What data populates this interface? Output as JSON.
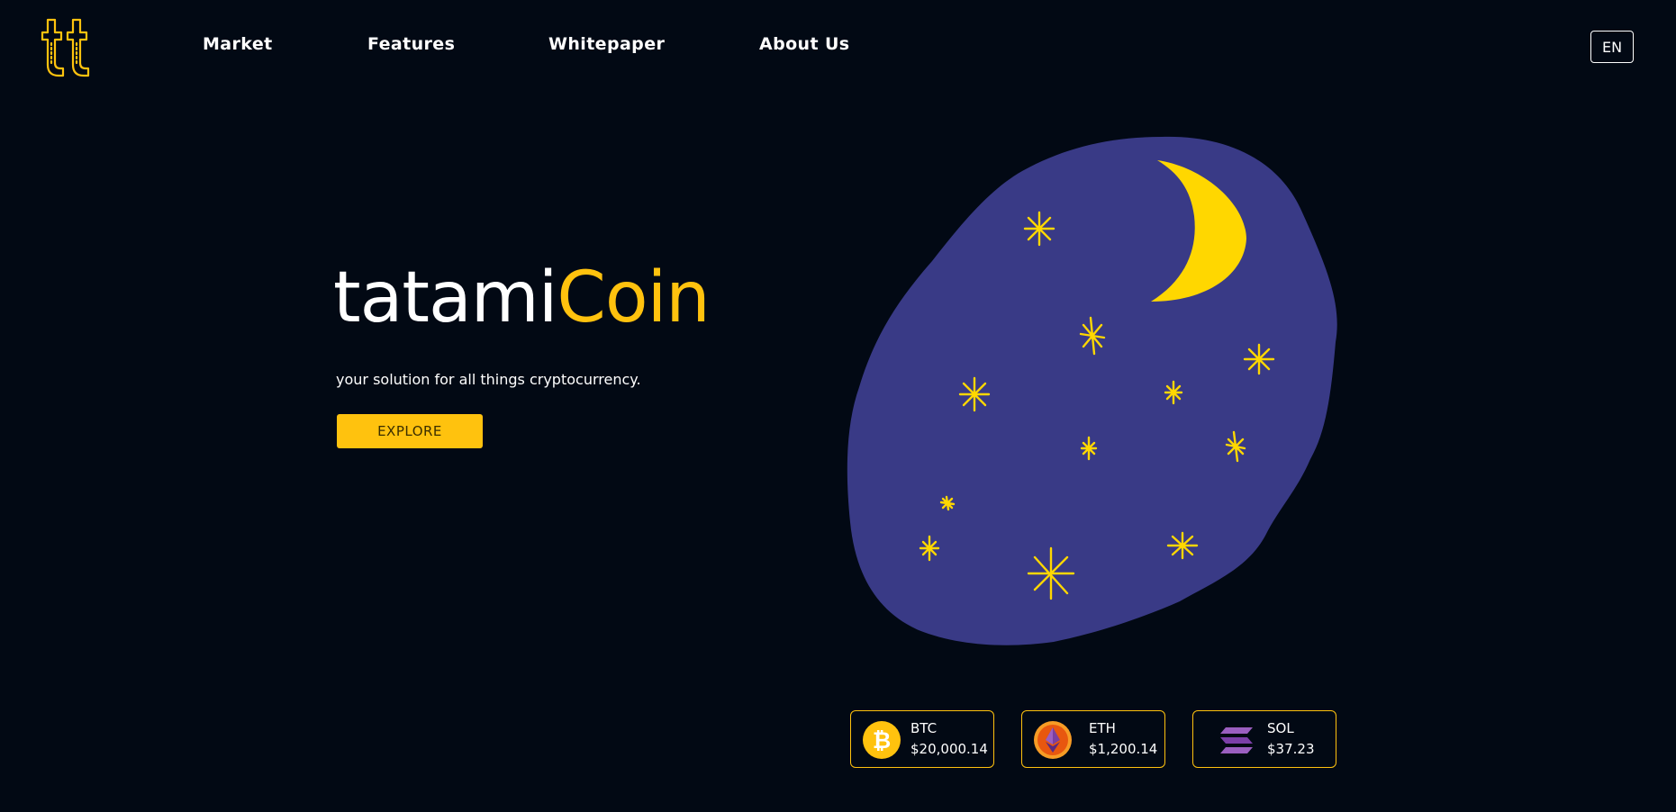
{
  "colors": {
    "background": "#020914",
    "accent": "#ffc20e",
    "blob": "#393a86",
    "text": "#ffffff"
  },
  "header": {
    "logo_text": "tt",
    "nav": [
      {
        "label": "Market"
      },
      {
        "label": "Features"
      },
      {
        "label": "Whitepaper"
      },
      {
        "label": "About Us"
      }
    ],
    "language": "EN"
  },
  "hero": {
    "title_main": "tatami",
    "title_accent": "Coin",
    "tagline": "your solution for all things cryptocurrency.",
    "cta_label": "EXPLORE"
  },
  "illustration": {
    "icons": [
      "moon-icon",
      "star-icon"
    ]
  },
  "tickers": [
    {
      "symbol": "BTC",
      "price": "$20,000.14",
      "icon": "bitcoin-icon"
    },
    {
      "symbol": "ETH",
      "price": "$1,200.14",
      "icon": "ethereum-icon"
    },
    {
      "symbol": "SOL",
      "price": "$37.23",
      "icon": "solana-icon"
    }
  ]
}
